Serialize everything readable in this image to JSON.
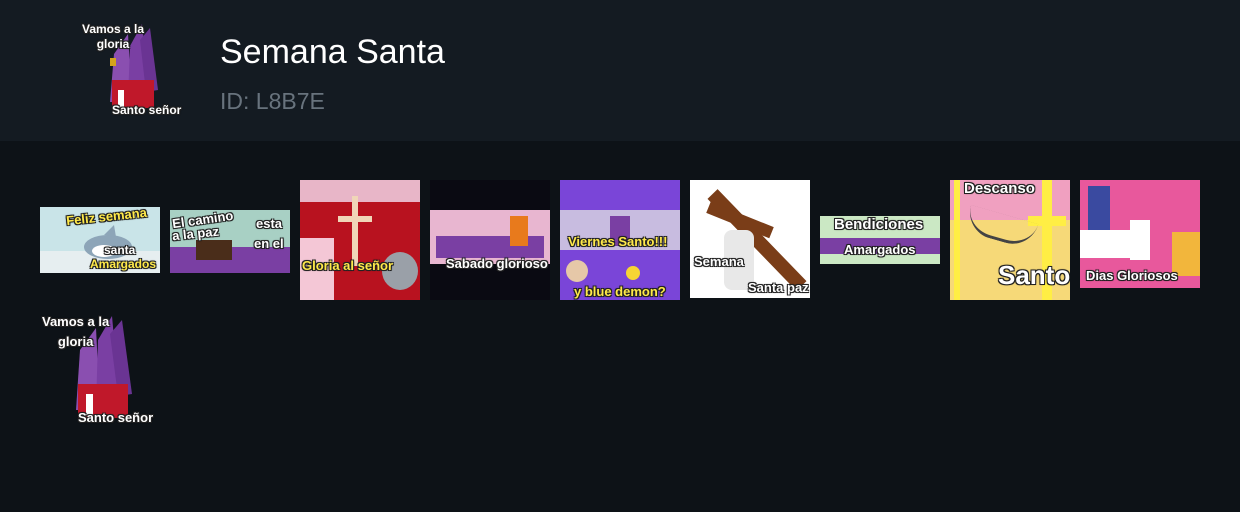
{
  "pack": {
    "title": "Semana Santa",
    "id_text": "ID: L8B7E",
    "icon": {
      "caption_top": "Vamos a la\ngloria",
      "caption_bottom": "Santo señor"
    }
  },
  "stickers": [
    {
      "captions": [
        "Feliz semana",
        "santa",
        "Amargados"
      ]
    },
    {
      "captions": [
        "El camino",
        "a la paz",
        "esta",
        "en el"
      ]
    },
    {
      "captions": [
        "Gloria al señor"
      ]
    },
    {
      "captions": [
        "Sabado glorioso"
      ]
    },
    {
      "captions": [
        "Viernes Santo!!!",
        "y blue demon?"
      ]
    },
    {
      "captions": [
        "Semana",
        "Santa paz"
      ]
    },
    {
      "captions": [
        "Bendiciones",
        "Amargados"
      ]
    },
    {
      "captions": [
        "Descanso",
        "Santo"
      ]
    },
    {
      "captions": [
        "Dias Gloriosos"
      ]
    },
    {
      "captions": [
        "Vamos a la\ngloria",
        "Santo señor"
      ]
    }
  ],
  "colors": {
    "background": "#0d1217",
    "header": "#141b22",
    "title": "#ffffff",
    "id": "#68737d",
    "purple": "#7a3fa3"
  }
}
